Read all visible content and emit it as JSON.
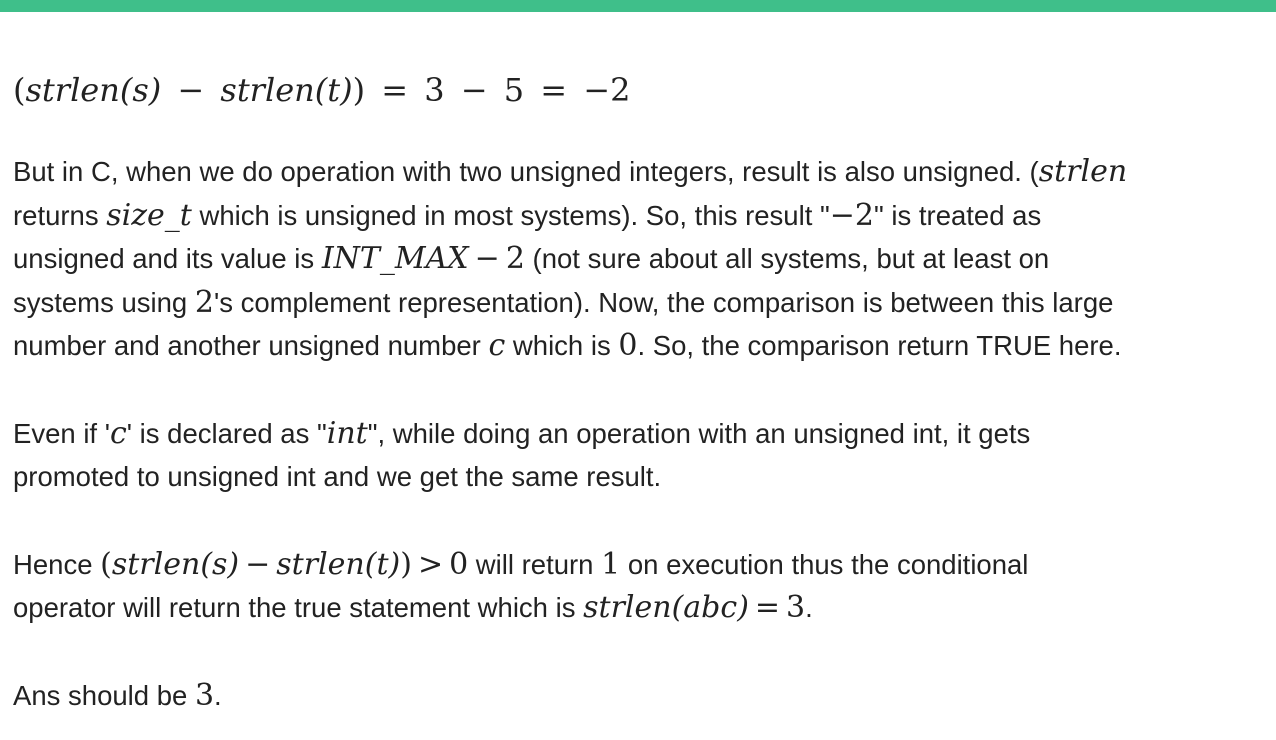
{
  "accent_color": "#3fbf8a",
  "equation": {
    "lhs_open": "(",
    "f1": "strlen",
    "a1": "(s)",
    "minus": "−",
    "f2": "strlen",
    "a2": "(t)",
    "lhs_close": ")",
    "eq1": "=",
    "n3": "3",
    "minus2": "−",
    "n5": "5",
    "eq2": "=",
    "result": "−2"
  },
  "p1": {
    "l1_text": "But in C, when we do operation with two unsigned integers, result is also unsigned. (",
    "l1_math": "strlen",
    "l2_text_a": "returns ",
    "l2_math": "size_t",
    "l2_text_b": " which is unsigned in most systems). So, this result \"",
    "l2_math2": "−2",
    "l2_text_c": "\" is treated as",
    "l3_text_a": "unsigned and its value is ",
    "l3_math": "INT_MAX",
    "l3_math_minus": "−",
    "l3_math_num": "2",
    "l3_text_b": " (not sure about all systems, but at least on",
    "l4_text_a": "systems using ",
    "l4_math": "2",
    "l4_text_b": "'s complement representation). Now, the comparison is between this large",
    "l5_text_a": "number and another unsigned number ",
    "l5_math": "c",
    "l5_text_b": " which is ",
    "l5_math2": "0",
    "l5_text_c": ". So, the comparison return TRUE here."
  },
  "p2": {
    "l1_text_a": "Even if '",
    "l1_math": "c",
    "l1_text_b": "' is declared as \"",
    "l1_math2": "int",
    "l1_text_c": "\", while doing an operation with an unsigned int, it gets",
    "l2_text": "promoted to unsigned int and we get the same result."
  },
  "p3": {
    "l1_text_a": "Hence ",
    "l1_m_open": "(",
    "l1_m_f1": "strlen",
    "l1_m_a1": "(s)",
    "l1_m_minus": "−",
    "l1_m_f2": "strlen",
    "l1_m_a2": "(t)",
    "l1_m_close": ")",
    "l1_m_gt": ">",
    "l1_m_zero": "0",
    "l1_text_b": " will return ",
    "l1_math_one": "1",
    "l1_text_c": " on execution thus the conditional",
    "l2_text_a": "operator will return the true statement which is ",
    "l2_m_f": "strlen",
    "l2_m_arg": "(abc)",
    "l2_m_eq": "=",
    "l2_m_three": "3",
    "l2_text_b": "."
  },
  "p4": {
    "text_a": "Ans should be ",
    "math": "3",
    "text_b": "."
  }
}
